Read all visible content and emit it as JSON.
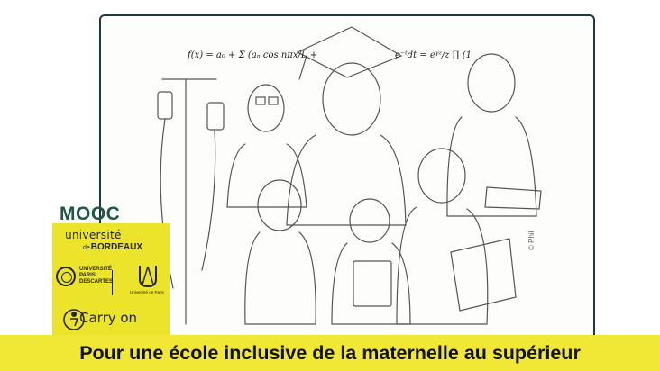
{
  "header": {
    "label": "MOOC"
  },
  "logos": {
    "bordeaux_line1": "université",
    "bordeaux_de": "de",
    "bordeaux_line2": "BORDEAUX",
    "paris_descartes": [
      "UNIVERSITÉ",
      "PARIS",
      "DESCARTES"
    ],
    "universite_de_paris": "Université de Paris",
    "carry_on": "Carry on"
  },
  "illustration": {
    "formula_left": "f(x) = a₀ + Σ (aₙ cos nπx/L +",
    "formula_right": "e⁻ᵗdt = eᵞᶻ/z ∏ (1",
    "credit": "© Phil"
  },
  "banner": {
    "title": "Pour une école inclusive de la maternelle au supérieur"
  },
  "colors": {
    "banner_bg": "#f0e834",
    "logo_panel_bg": "#ece42b",
    "mooc_text": "#1e5a42",
    "board_border": "#1f3a3a"
  }
}
